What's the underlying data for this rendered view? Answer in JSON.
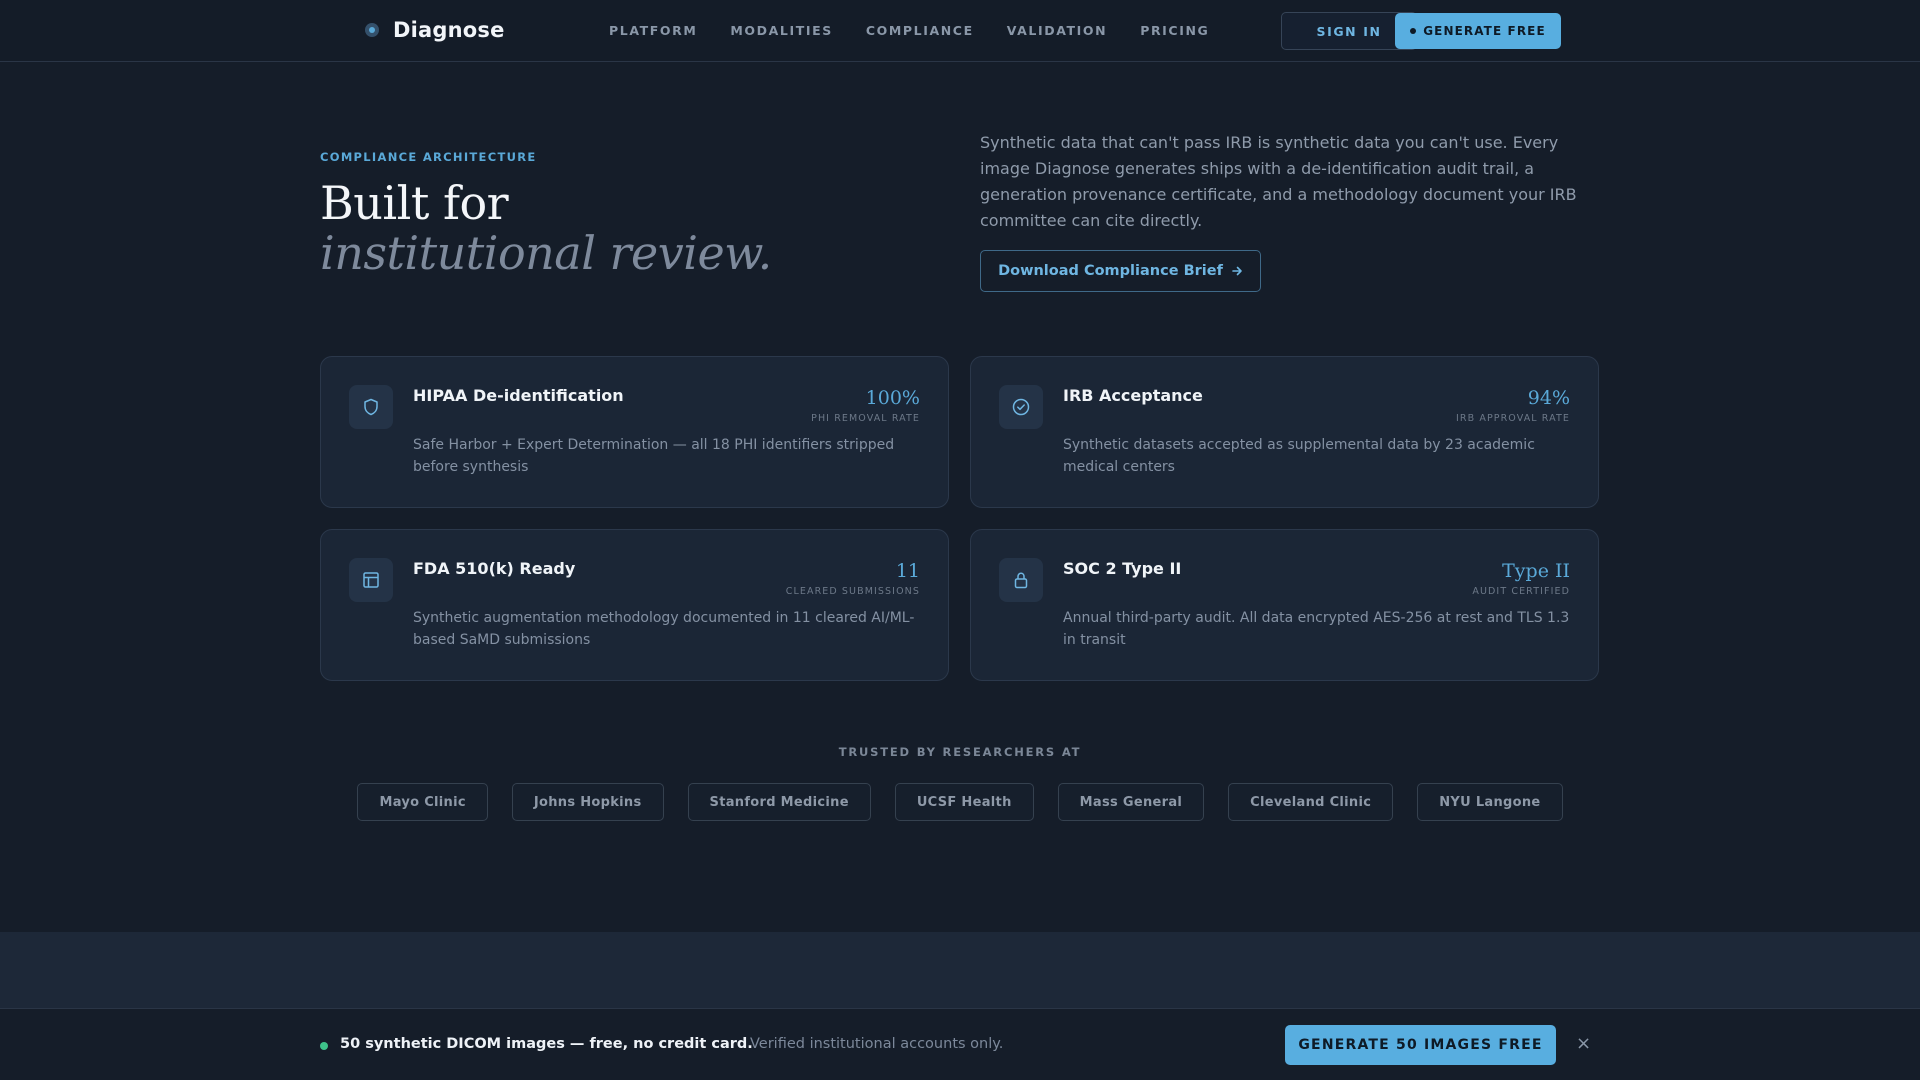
{
  "nav": {
    "brand": "Diagnose",
    "links": [
      "PLATFORM",
      "MODALITIES",
      "COMPLIANCE",
      "VALIDATION",
      "PRICING"
    ],
    "sign_in": "SIGN IN",
    "generate_free": "GENERATE FREE"
  },
  "hero": {
    "eyebrow": "COMPLIANCE ARCHITECTURE",
    "title_line1": "Built for",
    "title_line2": "institutional review.",
    "copy": "Synthetic data that can't pass IRB is synthetic data you can't use. Every image Diagnose generates ships with a de-identification audit trail, a generation provenance certificate, and a methodology document your IRB committee can cite directly.",
    "cta": "Download Compliance Brief"
  },
  "cards": [
    {
      "icon": "shield-icon",
      "title": "HIPAA De-identification",
      "metric": "100%",
      "metric_label": "PHI REMOVAL RATE",
      "desc": "Safe Harbor + Expert Determination — all 18 PHI identifiers stripped before synthesis"
    },
    {
      "icon": "check-circle-icon",
      "title": "IRB Acceptance",
      "metric": "94%",
      "metric_label": "IRB APPROVAL RATE",
      "desc": "Synthetic datasets accepted as supplemental data by 23 academic medical centers"
    },
    {
      "icon": "layout-icon",
      "title": "FDA 510(k) Ready",
      "metric": "11",
      "metric_label": "CLEARED SUBMISSIONS",
      "desc": "Synthetic augmentation methodology documented in 11 cleared AI/ML-based SaMD submissions"
    },
    {
      "icon": "lock-icon",
      "title": "SOC 2 Type II",
      "metric": "Type II",
      "metric_label": "AUDIT CERTIFIED",
      "desc": "Annual third-party audit. All data encrypted AES-256 at rest and TLS 1.3 in transit"
    }
  ],
  "trusted": {
    "label": "TRUSTED BY RESEARCHERS AT",
    "orgs": [
      "Mayo Clinic",
      "Johns Hopkins",
      "Stanford Medicine",
      "UCSF Health",
      "Mass General",
      "Cleveland Clinic",
      "NYU Langone"
    ]
  },
  "bottom_bar": {
    "headline": "50 synthetic DICOM images — free, no credit card.",
    "subtext": "Verified institutional accounts only.",
    "cta": "GENERATE 50 IMAGES FREE",
    "close": "×"
  },
  "colors": {
    "background": "#151d29",
    "accent": "#58aee0",
    "status_green": "#3ec28a"
  }
}
